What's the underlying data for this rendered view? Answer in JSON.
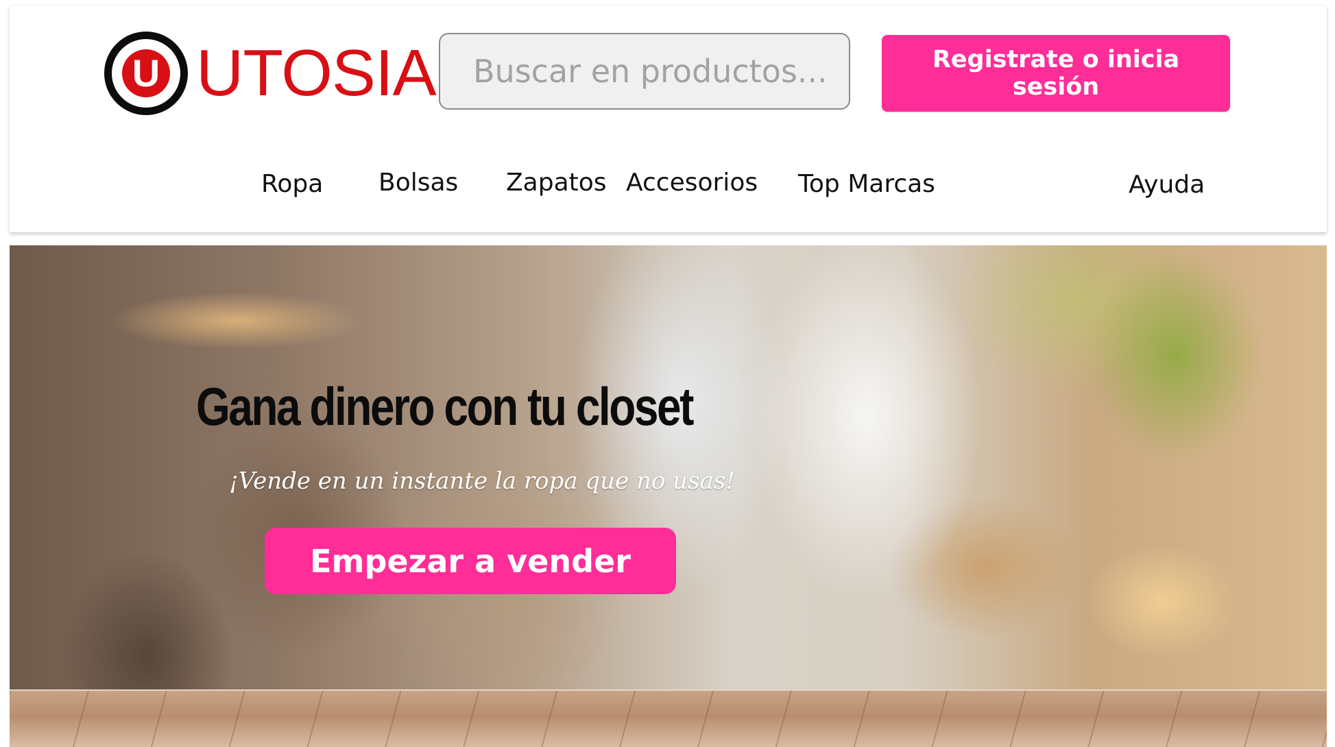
{
  "header": {
    "logo_mark": "U",
    "logo_text": "UTOSIA",
    "search_placeholder": "Buscar en productos...",
    "login_label": "Registrate o inicia sesión"
  },
  "nav": {
    "items": [
      "Ropa",
      "Bolsas",
      "Zapatos",
      "Accesorios",
      "Top Marcas"
    ],
    "help": "Ayuda"
  },
  "hero": {
    "title": "Gana dinero con tu closet",
    "subtitle": "¡Vende en un instante la ropa que no usas!",
    "cta_label": "Empezar a vender"
  },
  "colors": {
    "brand_red": "#d80f14",
    "accent_pink": "#ff2d97"
  }
}
